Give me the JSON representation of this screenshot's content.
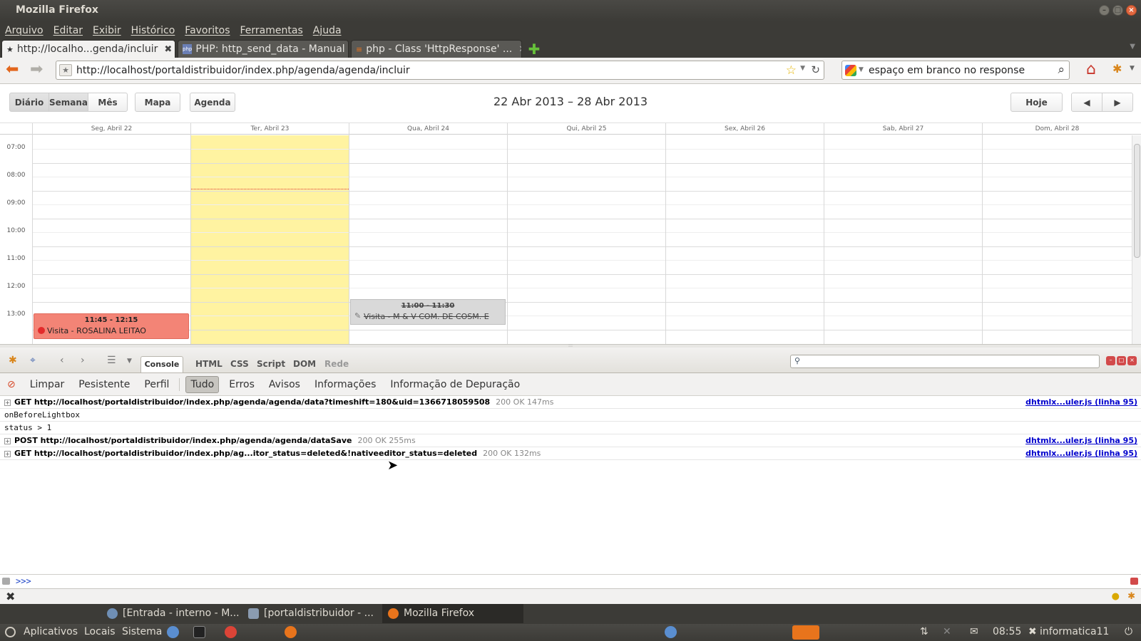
{
  "window": {
    "title": "Mozilla Firefox",
    "controls": [
      "–",
      "□",
      "×"
    ]
  },
  "menubar": [
    "Arquivo",
    "Editar",
    "Exibir",
    "Histórico",
    "Favoritos",
    "Ferramentas",
    "Ajuda"
  ],
  "tabs": [
    {
      "label": "http://localho...genda/incluir",
      "favicon": "★"
    },
    {
      "label": "PHP: http_send_data - Manual",
      "favicon": "php"
    },
    {
      "label": "php - Class 'HttpResponse' ...",
      "favicon": "≡"
    }
  ],
  "newtab_symbol": "✚",
  "navbar": {
    "url": "http://localhost/portaldistribuidor/index.php/agenda/agenda/incluir",
    "search_value": "espaço em branco no response"
  },
  "scheduler": {
    "buttons": {
      "day": "Diário",
      "week": "Semana",
      "month": "Mês",
      "map": "Mapa",
      "agenda": "Agenda",
      "today": "Hoje",
      "prev": "◀",
      "next": "▶"
    },
    "date_range": "22 Abr 2013 – 28 Abr 2013",
    "days": [
      "Seg, Abril 22",
      "Ter, Abril 23",
      "Qua, Abril 24",
      "Qui, Abril 25",
      "Sex, Abril 26",
      "Sab, Abril 27",
      "Dom, Abril 28"
    ],
    "hours": [
      "07:00",
      "08:00",
      "09:00",
      "10:00",
      "11:00",
      "12:00",
      "13:00"
    ],
    "events": [
      {
        "time": "11:45 - 12:15",
        "text": "Visita - ROSALINA LEITAO",
        "color": "#f38476"
      },
      {
        "time": "11:00 - 11:30",
        "text": "Visita - M & V COM. DE COSM. E",
        "color": "#d9d9d9"
      }
    ]
  },
  "firebug": {
    "panel_tabs": {
      "console": "Console",
      "html": "HTML",
      "css": "CSS",
      "script": "Script",
      "dom": "DOM",
      "net": "Rede"
    },
    "filters": [
      "Limpar",
      "Pesistente",
      "Perfil",
      "Tudo",
      "Erros",
      "Avisos",
      "Informações",
      "Informação de Depuração"
    ],
    "log": [
      {
        "type": "request",
        "text": "GET http://localhost/portaldistribuidor/index.php/agenda/agenda/data?timeshift=180&uid=1366718059508",
        "status": "200 OK 147ms",
        "source": "dhtmlx...uler.js (linha 95)"
      },
      {
        "type": "text",
        "text": "onBeforeLightbox"
      },
      {
        "type": "text",
        "text": "status > 1"
      },
      {
        "type": "request",
        "text": "POST http://localhost/portaldistribuidor/index.php/agenda/agenda/dataSave",
        "status": "200 OK 255ms",
        "source": "dhtmlx...uler.js (linha 95)"
      },
      {
        "type": "request",
        "text": "GET http://localhost/portaldistribuidor/index.php/ag...itor_status=deleted&!nativeeditor_status=deleted",
        "status": "200 OK 132ms",
        "source": "dhtmlx...uler.js (linha 95)"
      }
    ],
    "prompt": ">>>"
  },
  "taskbar": [
    {
      "label": "[Entrada - interno - M...",
      "color": "#6f8fb5"
    },
    {
      "label": "[portaldistribuidor - ...",
      "color": "#8a9bb0"
    },
    {
      "label": "Mozilla Firefox",
      "color": "#e8741c"
    }
  ],
  "panel": {
    "apps": "Aplicativos",
    "places": "Locais",
    "system": "Sistema",
    "clock": "08:55",
    "user": "informatica11"
  }
}
